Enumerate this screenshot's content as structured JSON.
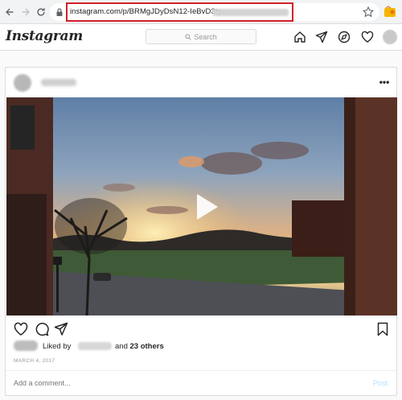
{
  "browser": {
    "url": "instagram.com/p/BRMgJDyDsN12-IeBvD3tg",
    "icons": [
      "back-icon",
      "forward-icon",
      "reload-icon",
      "lock-icon",
      "bookmark-star-icon",
      "extension-icon"
    ],
    "highlight_color": "#d1202a"
  },
  "header": {
    "logo": "Instagram",
    "search_placeholder": "Search",
    "icons": [
      "home-icon",
      "direct-message-icon",
      "explore-icon",
      "activity-heart-icon",
      "profile-avatar"
    ]
  },
  "post": {
    "media_type": "video",
    "actions": [
      "like-icon",
      "comment-icon",
      "share-icon",
      "save-icon"
    ],
    "likes_prefix": "Liked by",
    "likes_and": "and",
    "likes_others": "23 others",
    "date": "MARCH 4, 2017",
    "comment_placeholder": "Add a comment...",
    "post_button": "Post"
  },
  "colors": {
    "link_blue_disabled": "#b2dffc",
    "border": "#dbdbdb",
    "text": "#262626"
  }
}
